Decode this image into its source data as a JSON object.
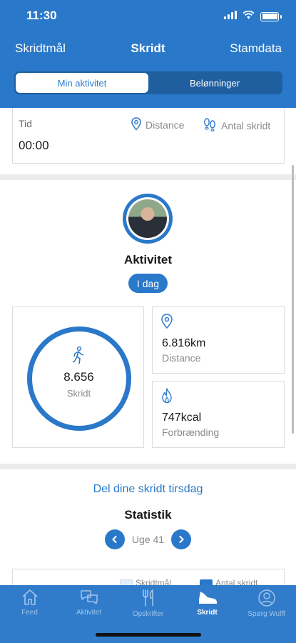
{
  "status_bar": {
    "time": "11:30"
  },
  "nav": {
    "left": "Skridtmål",
    "title": "Skridt",
    "right": "Stamdata"
  },
  "segments": [
    {
      "label": "Min aktivitet",
      "active": true
    },
    {
      "label": "Belønninger",
      "active": false
    }
  ],
  "summary": {
    "time_label": "Tid",
    "time_value": "00:00",
    "distance_tag": "Distance",
    "steps_tag": "Antal skridt"
  },
  "activity": {
    "title": "Aktivitet",
    "period": "I dag",
    "steps_value": "8.656",
    "steps_label": "Skridt",
    "distance_value": "6.816km",
    "distance_label": "Distance",
    "calories_value": "747kcal",
    "calories_label": "Forbrænding"
  },
  "share_link": "Del dine skridt tirsdag",
  "statistics": {
    "title": "Statistik",
    "week_label": "Uge 41",
    "legend": [
      {
        "label": "Skridtmål",
        "color": "#e4eef9"
      },
      {
        "label": "Antal skridt",
        "color": "#2a78c9"
      }
    ]
  },
  "tabs": [
    {
      "label": "Feed",
      "icon": "home-icon",
      "active": false
    },
    {
      "label": "Aktivitet",
      "icon": "chat-bubbles-icon",
      "active": false
    },
    {
      "label": "Opskrifter",
      "icon": "fork-knife-icon",
      "active": false
    },
    {
      "label": "Skridt",
      "icon": "shoe-icon",
      "active": true
    },
    {
      "label": "Spørg Wulff",
      "icon": "question-person-icon",
      "active": false
    }
  ],
  "colors": {
    "primary": "#2a78c9",
    "segment_bg": "#1f5f9f",
    "separator": "#ececec"
  }
}
